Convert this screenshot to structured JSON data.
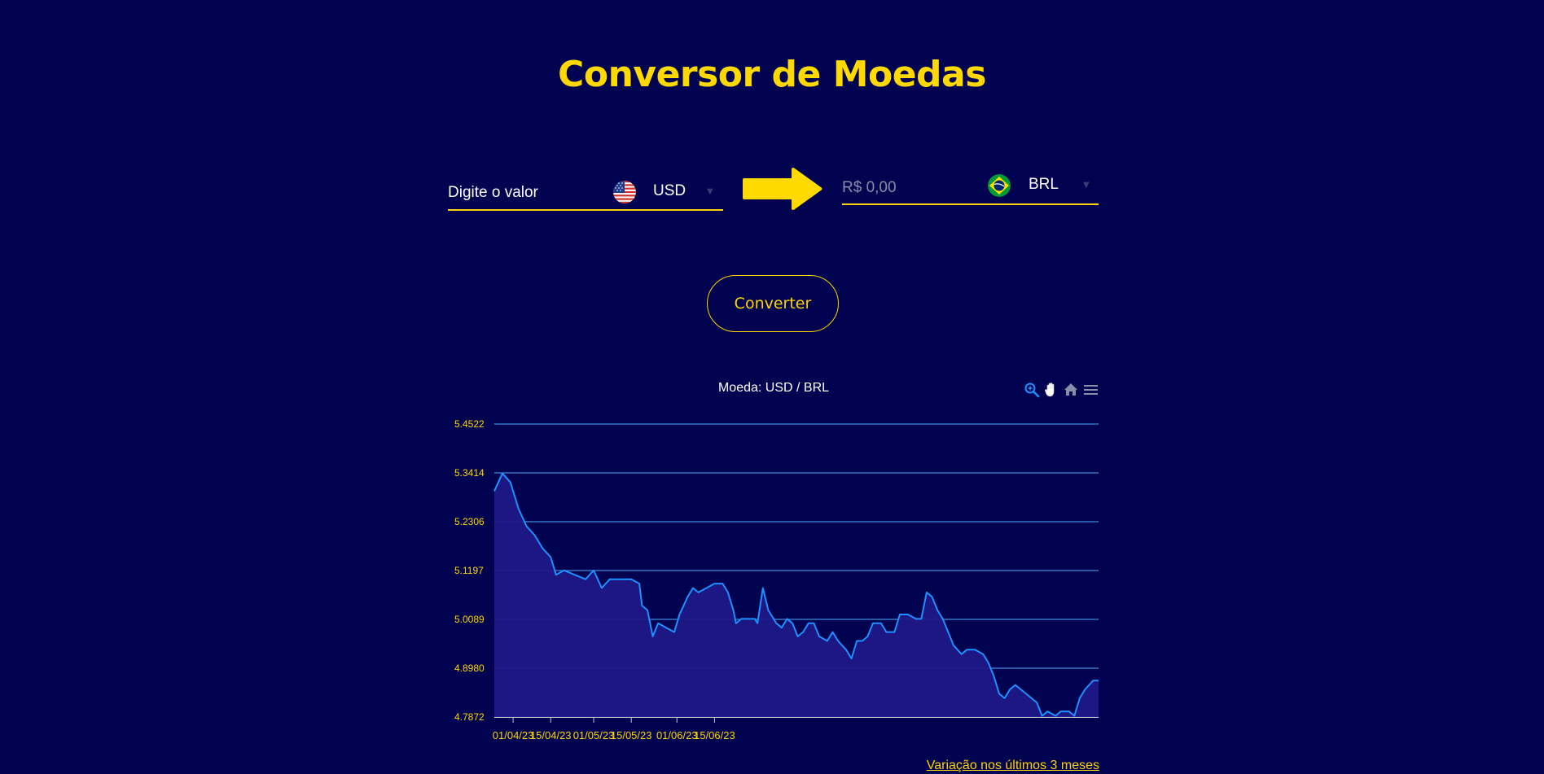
{
  "page": {
    "title": "Conversor de Moedas",
    "footer_link": "Variação nos últimos 3 meses"
  },
  "from": {
    "placeholder": "Digite o valor",
    "value": "",
    "currency": "USD",
    "flag_icon": "us-flag-icon"
  },
  "to": {
    "placeholder": "R$ 0,00",
    "value": "",
    "currency": "BRL",
    "flag_icon": "br-flag-icon"
  },
  "convert_button": {
    "label": "Converter"
  },
  "toolbar": {
    "zoom": "zoom-icon",
    "pan": "pan-hand-icon",
    "reset": "home-icon",
    "menu": "menu-icon"
  },
  "colors": {
    "background": "#010350",
    "accent": "#ffd400",
    "line": "#1e90ff",
    "area": "#1f1887",
    "grid": "#3c8bd8"
  },
  "chart_data": {
    "type": "area",
    "title": "Moeda: USD / BRL",
    "series": [
      {
        "values": [
          [
            0,
            5.3
          ],
          [
            3,
            5.34
          ],
          [
            6,
            5.32
          ],
          [
            9,
            5.26
          ],
          [
            12,
            5.22
          ],
          [
            15,
            5.2
          ],
          [
            18,
            5.17
          ],
          [
            21,
            5.15
          ],
          [
            23,
            5.11
          ],
          [
            26,
            5.12
          ],
          [
            30,
            5.11
          ],
          [
            34,
            5.1
          ],
          [
            37,
            5.12
          ],
          [
            40,
            5.08
          ],
          [
            43,
            5.1
          ],
          [
            47,
            5.1
          ],
          [
            51,
            5.1
          ],
          [
            54,
            5.09
          ],
          [
            55,
            5.04
          ],
          [
            57,
            5.03
          ],
          [
            59,
            4.97
          ],
          [
            61,
            5.0
          ],
          [
            64,
            4.99
          ],
          [
            67,
            4.98
          ],
          [
            69,
            5.02
          ],
          [
            72,
            5.06
          ],
          [
            74,
            5.08
          ],
          [
            76,
            5.07
          ],
          [
            79,
            5.08
          ],
          [
            82,
            5.09
          ],
          [
            85,
            5.09
          ],
          [
            87,
            5.07
          ],
          [
            89,
            5.03
          ],
          [
            90,
            5.0
          ],
          [
            92,
            5.01
          ],
          [
            95,
            5.01
          ],
          [
            97,
            5.01
          ],
          [
            98,
            5.0
          ],
          [
            100,
            5.08
          ],
          [
            102,
            5.03
          ],
          [
            105,
            5.0
          ],
          [
            107,
            4.99
          ],
          [
            109,
            5.01
          ],
          [
            111,
            5.0
          ],
          [
            113,
            4.97
          ],
          [
            115,
            4.98
          ],
          [
            117,
            5.0
          ],
          [
            119,
            5.0
          ],
          [
            121,
            4.97
          ],
          [
            124,
            4.96
          ],
          [
            126,
            4.98
          ],
          [
            128,
            4.96
          ],
          [
            131,
            4.94
          ],
          [
            133,
            4.92
          ],
          [
            135,
            4.96
          ],
          [
            137,
            4.96
          ],
          [
            139,
            4.97
          ],
          [
            141,
            5.0
          ],
          [
            144,
            5.0
          ],
          [
            146,
            4.98
          ],
          [
            149,
            4.98
          ],
          [
            151,
            5.02
          ],
          [
            154,
            5.02
          ],
          [
            157,
            5.01
          ],
          [
            159,
            5.01
          ],
          [
            161,
            5.07
          ],
          [
            163,
            5.06
          ],
          [
            165,
            5.03
          ],
          [
            167,
            5.01
          ],
          [
            169,
            4.98
          ],
          [
            171,
            4.95
          ],
          [
            174,
            4.93
          ],
          [
            176,
            4.94
          ],
          [
            179,
            4.94
          ],
          [
            182,
            4.93
          ],
          [
            184,
            4.91
          ],
          [
            186,
            4.88
          ],
          [
            188,
            4.84
          ],
          [
            190,
            4.83
          ],
          [
            192,
            4.85
          ],
          [
            194,
            4.86
          ],
          [
            196,
            4.85
          ],
          [
            198,
            4.84
          ],
          [
            200,
            4.83
          ],
          [
            202,
            4.82
          ],
          [
            204,
            4.79
          ],
          [
            206,
            4.8
          ],
          [
            209,
            4.79
          ],
          [
            211,
            4.8
          ],
          [
            214,
            4.8
          ],
          [
            216,
            4.79
          ],
          [
            218,
            4.83
          ],
          [
            220,
            4.85
          ],
          [
            223,
            4.87
          ],
          [
            225,
            4.87
          ]
        ]
      }
    ],
    "x_ticks": [
      "01/04/23",
      "15/04/23",
      "01/05/23",
      "15/05/23",
      "01/06/23",
      "15/06/23"
    ],
    "y_ticks": [
      "5.4522",
      "5.3414",
      "5.2306",
      "5.1197",
      "5.0089",
      "4.8980",
      "4.7872"
    ],
    "ylim": [
      4.7872,
      5.4522
    ],
    "grid": true
  }
}
